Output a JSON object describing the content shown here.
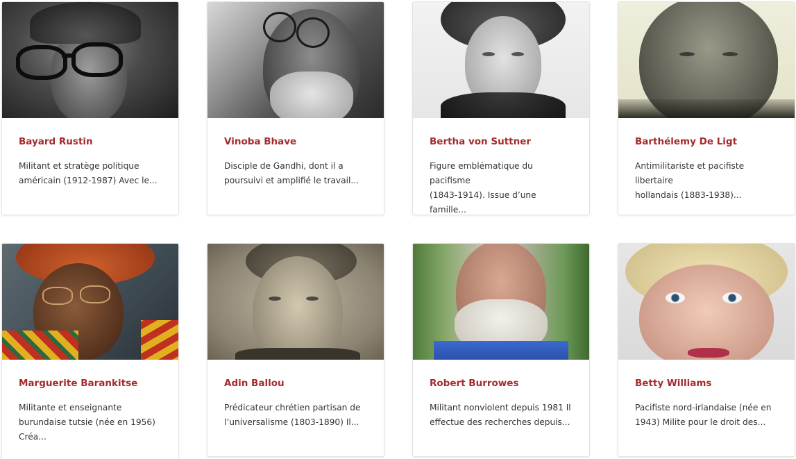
{
  "theme": {
    "name_color": "#a52a2a",
    "text_color": "#333333"
  },
  "cards": [
    {
      "name": "Bayard Rustin",
      "desc_line1": "Militant et stratège politique",
      "desc_line2": "américain (1912-1987) Avec le...",
      "desc_line3": "",
      "photo": "bw-portrait-glasses"
    },
    {
      "name": "Vinoba Bhave",
      "desc_line1": "Disciple de Gandhi, dont il a",
      "desc_line2": "poursuivi et amplifié le travail...",
      "desc_line3": "",
      "photo": "bw-portrait-beard-glasses"
    },
    {
      "name": "Bertha von Suttner",
      "desc_line1": "Figure emblématique du pacifisme",
      "desc_line2": "(1843-1914). Issue d’une famille...",
      "desc_line3": "",
      "photo": "bw-portrait-woman"
    },
    {
      "name": "Barthélemy De Ligt",
      "desc_line1": "Antimilitariste et pacifiste libertaire",
      "desc_line2": "hollandais (1883-1938)...",
      "desc_line3": "",
      "photo": "sepia-portrait-man"
    },
    {
      "name": "Marguerite Barankitse",
      "desc_line1": "Militante et enseignante",
      "desc_line2": "burundaise tutsie (née en 1956)",
      "desc_line3": "Créa...",
      "photo": "color-portrait-headwrap"
    },
    {
      "name": "Adin Ballou",
      "desc_line1": "Prédicateur chrétien partisan de",
      "desc_line2": "l’universalisme (1803-1890) Il...",
      "desc_line3": "",
      "photo": "sepia-portrait-engraving"
    },
    {
      "name": "Robert Burrowes",
      "desc_line1": "Militant nonviolent depuis 1981 Il",
      "desc_line2": "effectue des recherches depuis...",
      "desc_line3": "",
      "photo": "color-portrait-white-beard"
    },
    {
      "name": "Betty Williams",
      "desc_line1": "Pacifiste nord-irlandaise (née en",
      "desc_line2": "1943) Milite pour le droit des...",
      "desc_line3": "",
      "photo": "color-portrait-blonde-woman"
    }
  ]
}
